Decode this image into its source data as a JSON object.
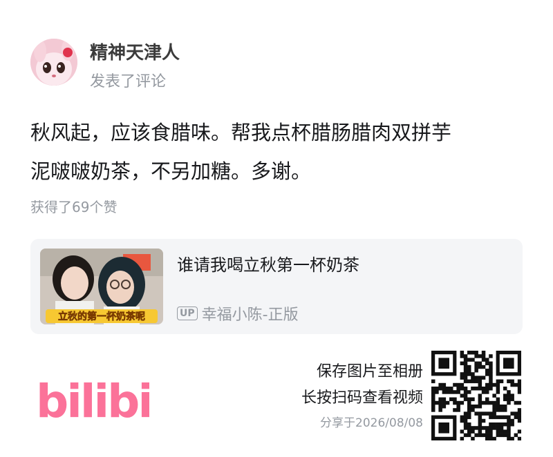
{
  "user": {
    "name": "精神天津人",
    "action": "发表了评论"
  },
  "comment": {
    "line1": "秋风起，应该食腊味。帮我点杯腊肠腊肉双拼芋",
    "line2": "泥啵啵奶茶，不另加糖。多谢。"
  },
  "likes": "获得了69个赞",
  "card": {
    "title": "谁请我喝立秋第一杯奶茶",
    "thumb_caption": "立秋的第一杯奶茶呢",
    "up_badge": "UP",
    "author": "幸福小陈-正版"
  },
  "footer": {
    "logo_text": "bilibili",
    "save_line1": "保存图片至相册",
    "save_line2": "长按扫码查看视频",
    "share_date": "分享于2026/08/08"
  },
  "colors": {
    "brand": "#fb7299",
    "text_primary": "#18191c",
    "text_secondary": "#9499a0",
    "card_bg": "#f4f5f7"
  }
}
